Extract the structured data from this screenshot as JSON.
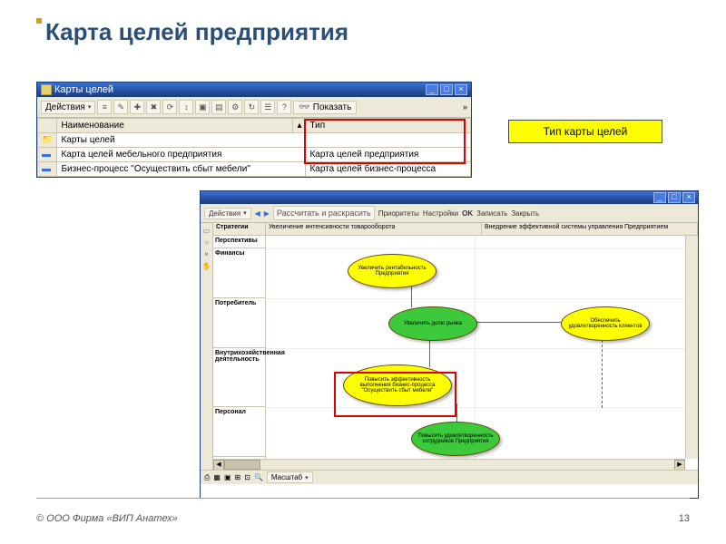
{
  "slide": {
    "title": "Карта целей предприятия",
    "copyright": "© ООО Фирма «ВИП Анатех»",
    "page_number": "13"
  },
  "win1": {
    "title": "Карты целей",
    "actions_label": "Действия",
    "show_label": "Показать",
    "more_label": "»",
    "columns": {
      "c1": "Наименование",
      "c2": "Тип"
    },
    "rows": [
      {
        "name": "Карты целей",
        "type": ""
      },
      {
        "name": "Карта целей мебельного предприятия",
        "type": "Карта целей предприятия"
      },
      {
        "name": "Бизнес-процесс ''Осуществить сбыт мебели''",
        "type": "Карта целей бизнес-процесса"
      }
    ]
  },
  "callout": {
    "text": "Тип карты целей"
  },
  "win2": {
    "toolbar": {
      "actions": "Действия",
      "calc": "Рассчитать и раскрасить",
      "priorities": "Приоритеты",
      "settings": "Настройки",
      "ok": "OK",
      "write": "Записать",
      "close": "Закрыть"
    },
    "header": {
      "col0": "Стратегии",
      "col1": "Увеличение интенсивности товарооборота",
      "col2": "Внедрение эффективной системы управления Предприятием"
    },
    "lanes": {
      "l0": "Перспективы",
      "l1": "Финансы",
      "l2": "Потребитель",
      "l3": "Внутрихозяйственная деятельность",
      "l4": "Персонал"
    },
    "goals": {
      "g1": "Увеличить рентабельность Предприятия",
      "g2": "Увеличить долю рынка",
      "g3": "Обеспечить удовлетворенность клиентов",
      "g4": "Повысить эффективность выполнения бизнес-процесса \"Осуществить сбыт мебели\"",
      "g5": "Повысить удовлетворенность сотрудников Предприятия"
    },
    "status": {
      "scale": "Масштаб"
    }
  }
}
